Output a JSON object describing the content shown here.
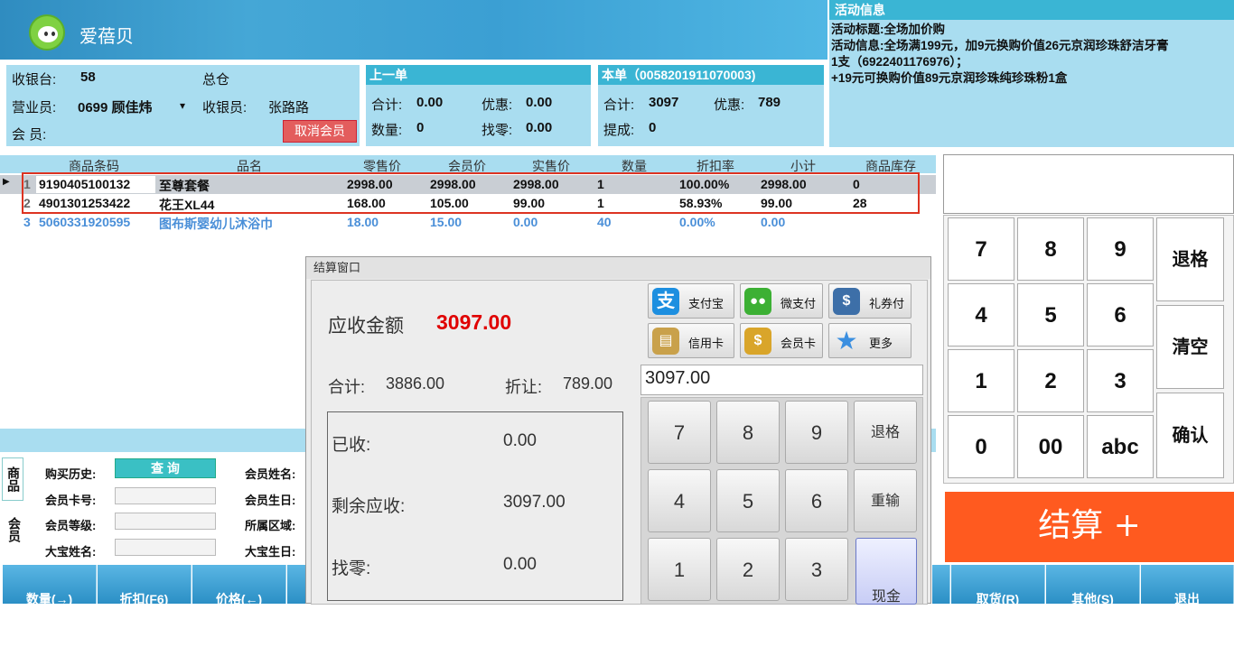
{
  "header": {
    "app_title": "爱蓓贝"
  },
  "activity": {
    "heading": "活动信息",
    "line1": "活动标题:全场加价购",
    "line2": "活动信息:全场满199元，加9元换购价值26元京润珍珠舒洁牙膏",
    "line3": "1支（6922401176976）；",
    "line4": "+19元可换购价值89元京润珍珠纯珍珠粉1盒"
  },
  "cashier": {
    "register_label": "收银台:",
    "register_value": "58",
    "warehouse": "总仓",
    "sales_label": "营业员:",
    "sales_value": "0699 顾佳炜",
    "sales_dropdown": "▾",
    "cashier_label": "收银员:",
    "cashier_value": "张路路",
    "member_label": "会  员:",
    "cancel_member": "取消会员"
  },
  "prev_order": {
    "heading": "上一单",
    "total_label": "合计:",
    "total_value": "0.00",
    "discount_label": "优惠:",
    "discount_value": "0.00",
    "qty_label": "数量:",
    "qty_value": "0",
    "change_label": "找零:",
    "change_value": "0.00"
  },
  "cur_order": {
    "heading": "本单（0058201911070003)",
    "total_label": "合计:",
    "total_value": "3097",
    "discount_label": "优惠:",
    "discount_value": "789",
    "pickup_label": "提成:",
    "pickup_value": "0"
  },
  "grid": {
    "columns": [
      "商品条码",
      "品名",
      "零售价",
      "会员价",
      "实售价",
      "数量",
      "折扣率",
      "小计",
      "商品库存"
    ],
    "rows": [
      {
        "no": "1",
        "barcode": "9190405100132",
        "name": "至尊套餐",
        "retail": "2998.00",
        "member": "2998.00",
        "actual": "2998.00",
        "qty": "1",
        "rate": "100.00%",
        "subtotal": "2998.00",
        "stock": "0"
      },
      {
        "no": "2",
        "barcode": "4901301253422",
        "name": "花王XL44",
        "retail": "168.00",
        "member": "105.00",
        "actual": "99.00",
        "qty": "1",
        "rate": "58.93%",
        "subtotal": "99.00",
        "stock": "28"
      },
      {
        "no": "3",
        "barcode": "5060331920595",
        "name": "图布斯婴幼儿沐浴巾",
        "retail": "18.00",
        "member": "15.00",
        "actual": "0.00",
        "qty": "40",
        "rate": "0.00%",
        "subtotal": "0.00",
        "stock": ""
      }
    ],
    "row_pointer": "▶"
  },
  "payment": {
    "window_title": "结算窗口",
    "due_label": "应收金额",
    "due_value": "3097.00",
    "sum_label": "合计:",
    "sum_value": "3886.00",
    "discount_label": "折让:",
    "discount_value": "789.00",
    "received_label": "已收:",
    "received_value": "0.00",
    "remaining_label": "剩余应收:",
    "remaining_value": "3097.00",
    "change_label": "找零:",
    "change_value": "0.00",
    "input_value": "3097.00",
    "methods": [
      "支付宝",
      "微支付",
      "礼券付",
      "信用卡",
      "会员卡",
      "更多"
    ],
    "keys": [
      "7",
      "8",
      "9",
      "退格",
      "4",
      "5",
      "6",
      "重输",
      "1",
      "2",
      "3",
      "现金"
    ]
  },
  "numpad": {
    "keys": [
      "7",
      "8",
      "9",
      "退格",
      "4",
      "5",
      "6",
      "清空",
      "1",
      "2",
      "3",
      "确认",
      "0",
      "00",
      "abc"
    ]
  },
  "checkout_button": "结算 +",
  "member_area": {
    "tab_goods": "商品",
    "tab_member": "会员",
    "history_label": "购买历史:",
    "query_button": "查 询",
    "card_label": "会员卡号:",
    "level_label": "会员等级:",
    "baby_name_label": "大宝姓名:",
    "name_label": "会员姓名:",
    "birthday_label": "会员生日:",
    "region_label": "所属区域:",
    "baby_birthday_label": "大宝生日:"
  },
  "bottom_buttons": [
    "数量(→)",
    "折扣(F6)",
    "价格(←)",
    "取货(R)",
    "其他(S)",
    "退出"
  ],
  "colors": {
    "accent": "#3ab5d4",
    "panel": "#a9ddf0",
    "due_red": "#e00000",
    "checkout": "#ff5a1f"
  }
}
